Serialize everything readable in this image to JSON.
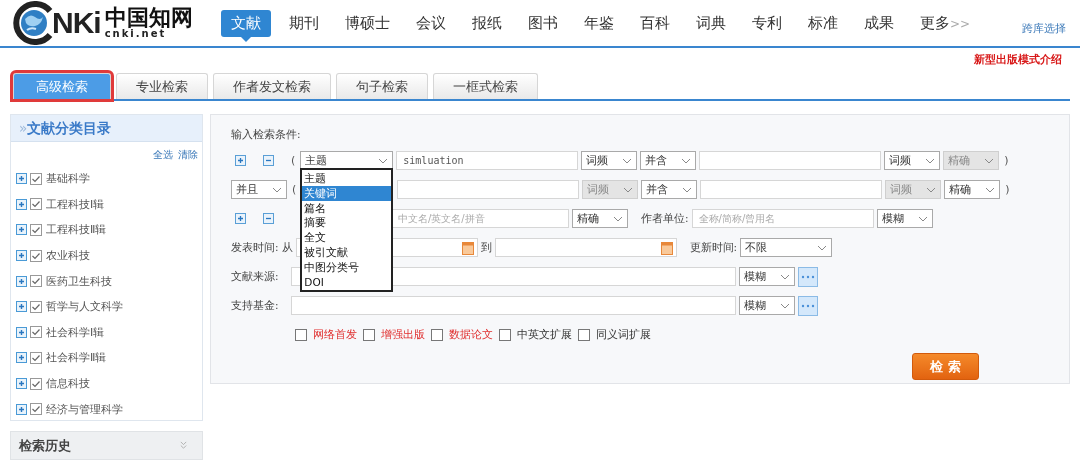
{
  "header": {
    "logo": {
      "mark": "NKi",
      "name": "中国知网",
      "domain": "cnki.net"
    },
    "nav": [
      {
        "label": "文献",
        "selected": true
      },
      {
        "label": "期刊",
        "selected": false
      },
      {
        "label": "博硕士",
        "selected": false
      },
      {
        "label": "会议",
        "selected": false
      },
      {
        "label": "报纸",
        "selected": false
      },
      {
        "label": "图书",
        "selected": false
      },
      {
        "label": "年鉴",
        "selected": false
      },
      {
        "label": "百科",
        "selected": false
      },
      {
        "label": "词典",
        "selected": false
      },
      {
        "label": "专利",
        "selected": false
      },
      {
        "label": "标准",
        "selected": false
      },
      {
        "label": "成果",
        "selected": false
      },
      {
        "label": "更多",
        "suffix": ">>",
        "selected": false
      }
    ],
    "cross_db": "跨库选择"
  },
  "promo_link": "新型出版模式介绍",
  "search_tabs": [
    {
      "label": "高级检索",
      "selected": true
    },
    {
      "label": "专业检索",
      "selected": false
    },
    {
      "label": "作者发文检索",
      "selected": false
    },
    {
      "label": "句子检索",
      "selected": false
    },
    {
      "label": "一框式检索",
      "selected": false
    }
  ],
  "sidebar": {
    "prefix": "»",
    "title": "文献分类目录",
    "select_all": "全选",
    "clear": "清除",
    "items": [
      {
        "label": "基础科学",
        "checked": true
      },
      {
        "label": "工程科技Ⅰ辑",
        "checked": true
      },
      {
        "label": "工程科技Ⅱ辑",
        "checked": true
      },
      {
        "label": "农业科技",
        "checked": true
      },
      {
        "label": "医药卫生科技",
        "checked": true
      },
      {
        "label": "哲学与人文科学",
        "checked": true
      },
      {
        "label": "社会科学Ⅰ辑",
        "checked": true
      },
      {
        "label": "社会科学Ⅱ辑",
        "checked": true
      },
      {
        "label": "信息科技",
        "checked": true
      },
      {
        "label": "经济与管理科学",
        "checked": true
      }
    ],
    "history_title": "检索历史"
  },
  "form": {
    "title": "输入检索条件:",
    "conditions": [
      {
        "open": "(",
        "field": "主题",
        "term": "simluation",
        "freq": {
          "text": "词频",
          "disabled": false
        },
        "relation": "并含",
        "freq2": {
          "text": "词频",
          "disabled": false
        },
        "match": {
          "text": "精确",
          "disabled": true
        },
        "close": ")"
      },
      {
        "logic": "并且",
        "open": "(",
        "freq": {
          "text": "词频",
          "disabled": true
        },
        "relation": "并含",
        "freq2": {
          "text": "词频",
          "disabled": true
        },
        "match": {
          "text": "精确",
          "disabled": false
        },
        "close": ")"
      }
    ],
    "field_options": [
      {
        "label": "主题",
        "selected": false
      },
      {
        "label": "关键词",
        "selected": true
      },
      {
        "label": "篇名",
        "selected": false
      },
      {
        "label": "摘要",
        "selected": false
      },
      {
        "label": "全文",
        "selected": false
      },
      {
        "label": "被引文献",
        "selected": false
      },
      {
        "label": "中图分类号",
        "selected": false
      },
      {
        "label": "DOI",
        "selected": false
      }
    ],
    "author": {
      "placeholder": "中文名/英文名/拼音",
      "match": "精确",
      "org_label": "作者单位:",
      "org_placeholder": "全称/简称/曾用名",
      "org_match": "模糊"
    },
    "date": {
      "label": "发表时间:",
      "from": "从",
      "to": "到",
      "update_label": "更新时间:",
      "update_value": "不限"
    },
    "sources": [
      {
        "label": "文献来源:",
        "match": "模糊"
      },
      {
        "label": "支持基金:",
        "match": "模糊"
      }
    ],
    "options": [
      {
        "label": "网络首发",
        "checked": false,
        "highlighted": true
      },
      {
        "label": "增强出版",
        "checked": false,
        "highlighted": true
      },
      {
        "label": "数据论文",
        "checked": false,
        "highlighted": true
      },
      {
        "label": "中英文扩展",
        "checked": false,
        "highlighted": false
      },
      {
        "label": "同义词扩展",
        "checked": false,
        "highlighted": false
      }
    ],
    "search_button": "检 索"
  }
}
